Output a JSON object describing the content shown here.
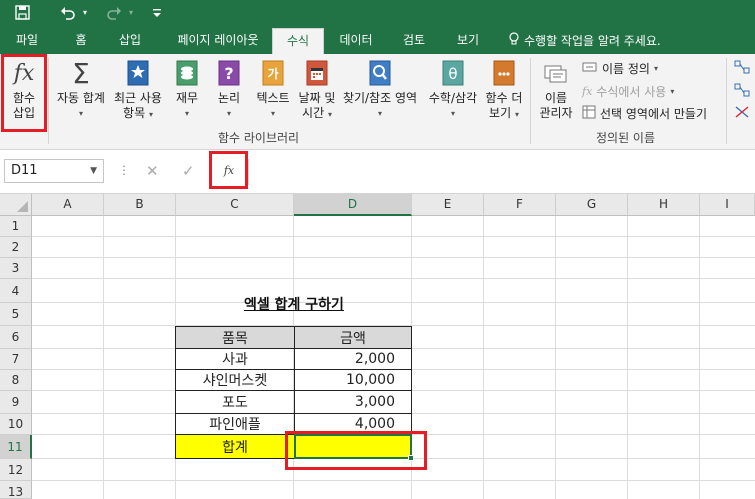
{
  "quick_access": {
    "save_icon": "save-icon",
    "undo_icon": "undo-icon",
    "redo_icon": "redo-icon",
    "customize_icon": "customize-qat-icon"
  },
  "tabs": [
    "파일",
    "홈",
    "삽입",
    "페이지 레이아웃",
    "수식",
    "데이터",
    "검토",
    "보기"
  ],
  "active_tab": "수식",
  "tell_me": "수행할 작업을 알려 주세요.",
  "ribbon": {
    "insert_function": [
      "함수",
      "삽입"
    ],
    "autosum": "자동 합계",
    "recent": [
      "최근 사용",
      "항목"
    ],
    "financial": "재무",
    "logical": "논리",
    "text": "텍스트",
    "datetime": [
      "날짜 및",
      "시간"
    ],
    "lookup": "찾기/참조 영역",
    "math": "수학/삼각",
    "more": [
      "함수 더",
      "보기"
    ],
    "library_label": "함수 라이브러리",
    "name_manager": [
      "이름",
      "관리자"
    ],
    "define_name": "이름 정의",
    "use_in_formula": "수식에서 사용",
    "create_from_selection": "선택 영역에서 만들기",
    "defined_names_label": "정의된 이름"
  },
  "formula_bar": {
    "name_box": "D11",
    "cancel": "✕",
    "enter": "✓",
    "fx": "fx",
    "value": ""
  },
  "columns": [
    "A",
    "B",
    "C",
    "D",
    "E",
    "F",
    "G",
    "H",
    "I"
  ],
  "selected_column": "D",
  "rows": [
    "1",
    "2",
    "3",
    "4",
    "5",
    "6",
    "7",
    "8",
    "9",
    "10",
    "11",
    "12",
    "13"
  ],
  "selected_row": "11",
  "sheet": {
    "title": "엑셀 합계 구하기",
    "header": [
      "품목",
      "금액"
    ],
    "items": [
      {
        "name": "사과",
        "amount": "2,000"
      },
      {
        "name": "샤인머스켓",
        "amount": "10,000"
      },
      {
        "name": "포도",
        "amount": "3,000"
      },
      {
        "name": "파인애플",
        "amount": "4,000"
      }
    ],
    "total_label": "합계",
    "total_value": ""
  },
  "colors": {
    "excel_green": "#217346",
    "highlight_yellow": "#ffff00",
    "header_gray": "#d9d9d9",
    "callout_red": "#e31e24"
  }
}
